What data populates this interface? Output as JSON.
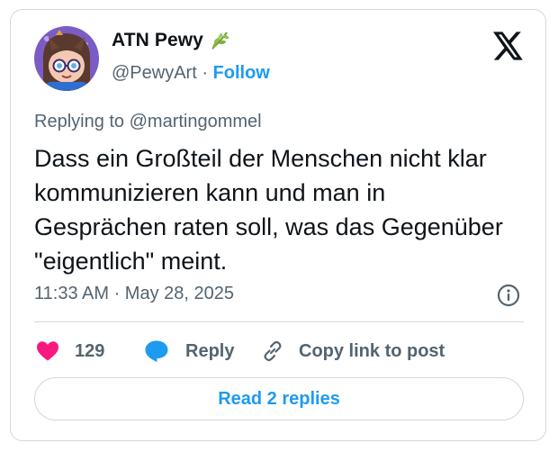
{
  "author": {
    "display_name": "ATN Pewy",
    "emoji": "🌿",
    "handle": "@PewyArt",
    "separator": "·",
    "follow_label": "Follow"
  },
  "tweet": {
    "replying_to": "Replying to @martingommel",
    "text": "Dass ein Großteil der Menschen nicht klar kommunizieren kann und man in Gesprächen raten soll, was das Gegenüber \"eigentlich\" meint.",
    "timestamp": "11:33 AM · May 28, 2025"
  },
  "actions": {
    "like_count": "129",
    "reply_label": "Reply",
    "copy_link_label": "Copy link to post"
  },
  "footer": {
    "read_replies_label": "Read 2 replies"
  },
  "icons": {
    "logo": "x-logo-icon",
    "info": "info-icon",
    "like": "heart-icon",
    "reply": "speech-bubble-icon",
    "copy": "link-icon"
  },
  "colors": {
    "accent": "#1d9bf0",
    "like": "#f91880",
    "secondary_text": "#536471",
    "border": "#cfd9de"
  }
}
